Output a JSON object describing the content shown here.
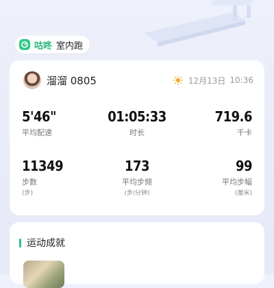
{
  "header": {
    "brand": "咕咚",
    "mode": "室内跑",
    "logo_icon": "gudong-logo-icon"
  },
  "user": {
    "name": "溜溜 0805",
    "date": "12月13日",
    "time": "10:36",
    "weather_icon": "sun-icon"
  },
  "stats": {
    "pace": {
      "value": "5'46\"",
      "label": "平均配速"
    },
    "duration": {
      "value": "01:05:33",
      "label": "时长"
    },
    "calories": {
      "value": "719.6",
      "label": "千卡"
    },
    "steps": {
      "value": "11349",
      "label": "步数",
      "unit": "(步)"
    },
    "cadence": {
      "value": "173",
      "label": "平均步频",
      "unit": "(步/分钟)"
    },
    "stride": {
      "value": "99",
      "label": "平均步幅",
      "unit": "(厘米)"
    }
  },
  "achievements": {
    "title": "运动成就"
  },
  "colors": {
    "accent": "#2fc28a",
    "brand": "#27b678"
  }
}
